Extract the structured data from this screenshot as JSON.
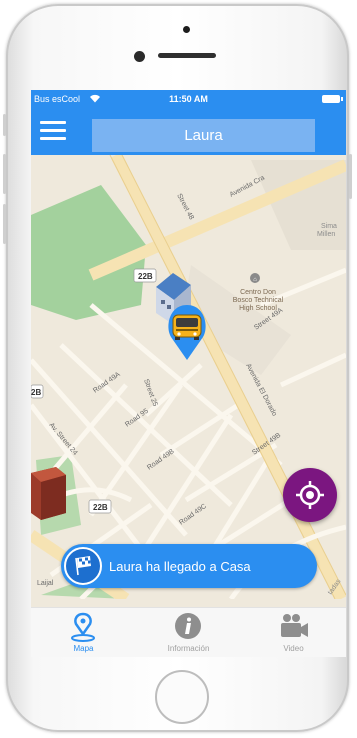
{
  "status_bar": {
    "carrier": "Bus esCool",
    "time": "11:50 AM"
  },
  "header": {
    "title": "Laura",
    "menu_icon": "hamburger-menu-icon"
  },
  "map": {
    "street_labels": [
      "Avenida Cra",
      "Avenida El Dorado",
      "Av. Street 24",
      "Street 25",
      "Road 95",
      "Road 49A",
      "Road 49B",
      "Street 49A",
      "Street 49B",
      "Road 49C",
      "Street 48",
      "Laijal"
    ],
    "route_badges": [
      "22B",
      "22B",
      "2B"
    ],
    "poi": {
      "name_line1": "Centro Don",
      "name_line2": "Bosco Technical",
      "name_line3": "High School"
    },
    "poi_right_line1": "Sima",
    "poi_right_line2": "Millen",
    "edge_text": "tadas",
    "bus_marker_icon": "school-bus-marker-icon",
    "home_marker_icon": "home-marker-icon",
    "colors": {
      "park": "#9fcf9a",
      "road": "#fbf6ea",
      "major_road": "#f5e0ad",
      "background": "#efe9dc"
    }
  },
  "locate_button": {
    "icon": "locate-crosshair-icon",
    "color": "#7b1680"
  },
  "notification": {
    "text": "Laura ha llegado a Casa",
    "icon": "checkered-flag-icon"
  },
  "tabs": [
    {
      "label": "Mapa",
      "icon": "map-pin-icon",
      "active": true
    },
    {
      "label": "Información",
      "icon": "info-icon",
      "active": false
    },
    {
      "label": "Video",
      "icon": "video-camera-icon",
      "active": false
    }
  ],
  "colors": {
    "primary": "#2b8ef0",
    "accent": "#7b1680"
  }
}
